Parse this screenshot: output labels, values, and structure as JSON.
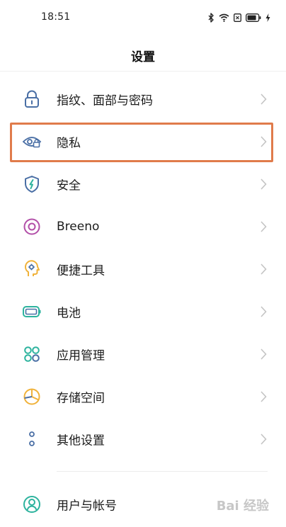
{
  "status_bar": {
    "time": "18:51",
    "icons": [
      "bluetooth-icon",
      "wifi-icon",
      "sim-icon",
      "battery-icon",
      "charging-icon"
    ]
  },
  "header": {
    "title": "设置"
  },
  "settings": {
    "items": [
      {
        "label": "指纹、面部与密码",
        "icon": "lock-icon"
      },
      {
        "label": "隐私",
        "icon": "privacy-eye-icon"
      },
      {
        "label": "安全",
        "icon": "shield-icon"
      },
      {
        "label": "Breeno",
        "icon": "breeno-icon"
      },
      {
        "label": "便捷工具",
        "icon": "tools-icon"
      },
      {
        "label": "电池",
        "icon": "battery-icon"
      },
      {
        "label": "应用管理",
        "icon": "apps-icon"
      },
      {
        "label": "存储空间",
        "icon": "storage-icon"
      },
      {
        "label": "其他设置",
        "icon": "more-icon"
      }
    ],
    "bottom_item": {
      "label": "用户与帐号",
      "icon": "user-icon"
    }
  },
  "highlight": {
    "target": "隐私",
    "color": "#e07b4b"
  },
  "watermark": {
    "text": "Bai 经验"
  },
  "colors": {
    "accent_blue": "#4a6fa5",
    "accent_green": "#2db39e",
    "accent_purple": "#b24fa8",
    "accent_orange": "#f0b23a",
    "chevron": "#c4c4c4"
  }
}
